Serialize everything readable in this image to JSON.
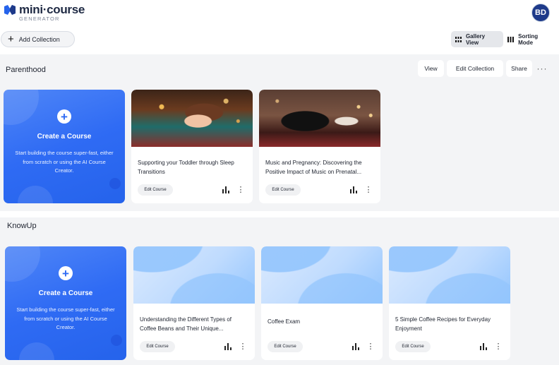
{
  "app": {
    "logo_main": "mini·course",
    "logo_sub": "GENERATOR",
    "avatar_initials": "BD"
  },
  "toolbar": {
    "add_collection": "Add Collection",
    "gallery_view": "Gallery View",
    "sorting_mode": "Sorting Mode",
    "active_view": "gallery"
  },
  "collections": [
    {
      "name": "Parenthood",
      "actions": {
        "view": "View",
        "edit": "Edit Collection",
        "share": "Share",
        "more": "···"
      },
      "create_card": {
        "title": "Create a Course",
        "description": "Start building the course super-fast, either from scratch or using the AI Course Creator."
      },
      "courses": [
        {
          "title": "Supporting your Toddler through Sleep Transitions",
          "edit_label": "Edit Course",
          "thumbnail": "toddler-sleeping-photo"
        },
        {
          "title": "Music and Pregnancy: Discovering the Positive Impact of Music on Prenatal...",
          "edit_label": "Edit Course",
          "thumbnail": "pregnant-woman-piano-photo"
        }
      ]
    },
    {
      "name": "KnowUp",
      "create_card": {
        "title": "Create a Course",
        "description": "Start building the course super-fast, either from scratch or using the AI Course Creator."
      },
      "courses": [
        {
          "title": "Understanding the Different Types of Coffee Beans and Their Unique...",
          "edit_label": "Edit Course",
          "thumbnail": "blue-placeholder"
        },
        {
          "title": "Coffee Exam",
          "edit_label": "Edit Course",
          "thumbnail": "blue-placeholder"
        },
        {
          "title": "5 Simple Coffee Recipes for Everyday Enjoyment",
          "edit_label": "Edit Course",
          "thumbnail": "blue-placeholder"
        }
      ]
    }
  ],
  "colors": {
    "primary": "#2f6bf4",
    "avatar_bg": "#1e3a8a",
    "section_bg": "#f3f4f6"
  }
}
